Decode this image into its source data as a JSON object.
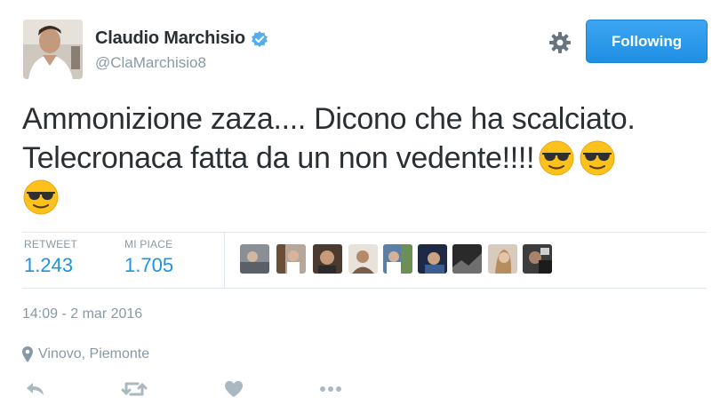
{
  "user": {
    "display_name": "Claudio Marchisio",
    "handle": "@ClaMarchisio8",
    "verified": true,
    "avatar_icon": "profile-photo"
  },
  "follow_button": {
    "label": "Following",
    "color": "#2b9cf0"
  },
  "tweet": {
    "lines": [
      "Ammonizione zaza.... Dicono che ha scalciato.",
      "Telecronaca fatta da un non vedente!!!!"
    ],
    "emoji": "smiling-face-with-sunglasses",
    "emoji_count": 3
  },
  "stats": {
    "retweets_label": "RETWEET",
    "retweets_value": "1.243",
    "likes_label": "MI PIACE",
    "likes_value": "1.705",
    "accent": "#1b95e0"
  },
  "likers": [
    {
      "name": "liker-avatar"
    },
    {
      "name": "liker-avatar"
    },
    {
      "name": "liker-avatar"
    },
    {
      "name": "liker-avatar"
    },
    {
      "name": "liker-avatar"
    },
    {
      "name": "liker-avatar"
    },
    {
      "name": "liker-avatar"
    },
    {
      "name": "liker-avatar"
    },
    {
      "name": "liker-avatar"
    }
  ],
  "timestamp": "14:09 - 2 mar 2016",
  "location": "Vinovo, Piemonte",
  "actions": [
    "reply-icon",
    "retweet-icon",
    "like-icon",
    "more-icon"
  ]
}
